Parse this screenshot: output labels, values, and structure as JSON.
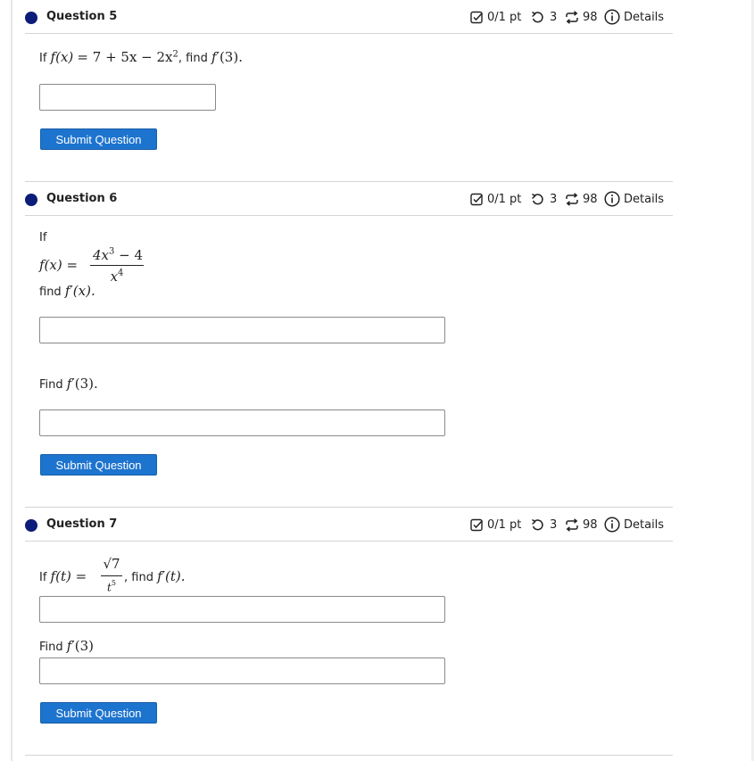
{
  "meta": {
    "score": "0/1 pt",
    "retries": "3",
    "attempts": "98",
    "details": "Details"
  },
  "questions": [
    {
      "title": "Question 5",
      "prefix": "If ",
      "fx": "f",
      "fx_paren": "(x)",
      "expr": "= 7 + 5x − 2x",
      "sup2": "2",
      "mid": ", find ",
      "fprime": "f",
      "fprime_arg": "′(3).",
      "submit": "Submit Question"
    },
    {
      "title": "Question 6",
      "if": "If",
      "lhs": "f(x) =",
      "num": "4x",
      "num_sup": "3",
      "num_tail": " − 4",
      "den": "x",
      "den_sup": "4",
      "find1": "find ",
      "find1_f": "f",
      "find1_arg": "′(x).",
      "find2": "Find ",
      "find2_f": "f",
      "find2_arg": "′(3).",
      "submit": "Submit Question"
    },
    {
      "title": "Question 7",
      "prefix": "If ",
      "lhs": "f(t) =",
      "num": "√7",
      "den": "t",
      "den_sup": "5",
      "mid": ", find ",
      "fprime": "f",
      "fprime_arg": "′(t).",
      "find2": "Find ",
      "find2_f": "f",
      "find2_arg": "′(3)",
      "submit": "Submit Question"
    }
  ],
  "colors": {
    "dot": "#0b1d79",
    "button": "#1d74cf",
    "divider": "#d4d4d4"
  },
  "icons": [
    "check-box-icon",
    "retry-icon",
    "attempts-icon",
    "info-icon"
  ]
}
